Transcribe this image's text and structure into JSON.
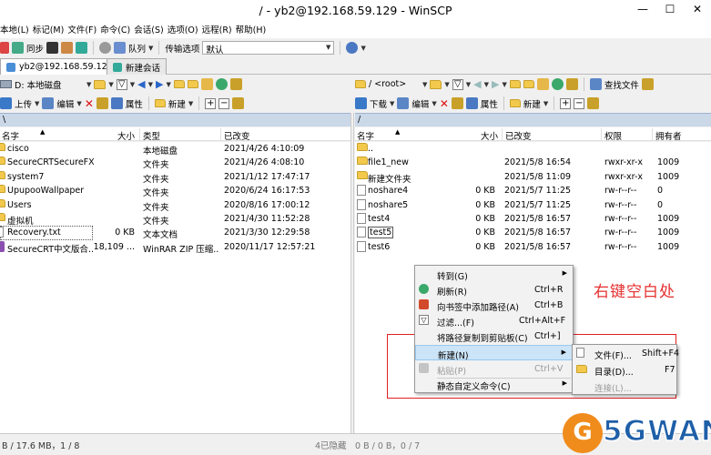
{
  "window": {
    "title": "/ - yb2@192.168.59.129 - WinSCP",
    "minimize": "—",
    "maximize": "☐",
    "close": "✕"
  },
  "menu": [
    "本地(L)",
    "标记(M)",
    "文件(F)",
    "命令(C)",
    "会话(S)",
    "选项(O)",
    "远程(R)",
    "帮助(H)"
  ],
  "toolbar": {
    "sync": "同步",
    "queue": "队列",
    "transfer_label": "传输选项",
    "transfer_value": "默认"
  },
  "tabs": {
    "session": "yb2@192.168.59.129",
    "new_session": "新建会话"
  },
  "local": {
    "drive": "D: 本地磁盘",
    "upload": "上传",
    "edit": "编辑",
    "props": "属性",
    "new": "新建",
    "path": "\\",
    "headers": {
      "name": "名字",
      "size": "大小",
      "type": "类型",
      "changed": "已改变"
    },
    "rows": [
      {
        "name": "cisco",
        "size": "",
        "type": "本地磁盘",
        "changed": "2021/4/26   4:10:09",
        "icon": "folder"
      },
      {
        "name": "SecureCRTSecureFX...",
        "size": "",
        "type": "文件夹",
        "changed": "2021/4/26   4:08:10",
        "icon": "folder"
      },
      {
        "name": "system7",
        "size": "",
        "type": "文件夹",
        "changed": "2021/1/12   17:47:17",
        "icon": "folder"
      },
      {
        "name": "UpupooWallpaper",
        "size": "",
        "type": "文件夹",
        "changed": "2020/6/24   16:17:53",
        "icon": "folder"
      },
      {
        "name": "Users",
        "size": "",
        "type": "文件夹",
        "changed": "2020/8/16   17:00:12",
        "icon": "folder"
      },
      {
        "name": "虚拟机",
        "size": "",
        "type": "文件夹",
        "changed": "2021/4/30   11:52:28",
        "icon": "folder"
      },
      {
        "name": "Recovery.txt",
        "size": "0 KB",
        "type": "文本文档",
        "changed": "2021/3/30   12:29:58",
        "icon": "file"
      },
      {
        "name": "SecureCRT中文版合...",
        "size": "18,109 ...",
        "type": "WinRAR ZIP 压缩...",
        "changed": "2020/11/17   12:57:21",
        "icon": "zip"
      }
    ],
    "status": "B / 17.6 MB，1 / 8"
  },
  "remote": {
    "root": "/ <root>",
    "find": "查找文件",
    "download": "下载",
    "edit": "编辑",
    "props": "属性",
    "new": "新建",
    "path": "/",
    "headers": {
      "name": "名字",
      "size": "大小",
      "changed": "已改变",
      "perms": "权限",
      "owner": "拥有者"
    },
    "rows": [
      {
        "name": "..",
        "size": "",
        "changed": "",
        "perms": "",
        "owner": "",
        "icon": "up"
      },
      {
        "name": "file1_new",
        "size": "",
        "changed": "2021/5/8 16:54",
        "perms": "rwxr-xr-x",
        "owner": "1009",
        "icon": "folder"
      },
      {
        "name": "新建文件夹",
        "size": "",
        "changed": "2021/5/8 11:09",
        "perms": "rwxr-xr-x",
        "owner": "1009",
        "icon": "folder"
      },
      {
        "name": "noshare4",
        "size": "0 KB",
        "changed": "2021/5/7 11:25",
        "perms": "rw-r--r--",
        "owner": "0",
        "icon": "file"
      },
      {
        "name": "noshare5",
        "size": "0 KB",
        "changed": "2021/5/7 11:25",
        "perms": "rw-r--r--",
        "owner": "0",
        "icon": "file"
      },
      {
        "name": "test4",
        "size": "0 KB",
        "changed": "2021/5/8 16:57",
        "perms": "rw-r--r--",
        "owner": "1009",
        "icon": "file"
      },
      {
        "name": "test5",
        "size": "0 KB",
        "changed": "2021/5/8 16:57",
        "perms": "rw-r--r--",
        "owner": "1009",
        "icon": "file"
      },
      {
        "name": "test6",
        "size": "0 KB",
        "changed": "2021/5/8 16:57",
        "perms": "rw-r--r--",
        "owner": "1009",
        "icon": "file"
      }
    ],
    "status_hidden": "4已隐藏",
    "status": "0 B / 0 B，0 / 7"
  },
  "context_menu": {
    "items": [
      {
        "label": "转到(G)",
        "shortcut": "",
        "sub": true
      },
      {
        "label": "刷新(R)",
        "shortcut": "Ctrl+R"
      },
      {
        "label": "向书签中添加路径(A)",
        "shortcut": "Ctrl+B"
      },
      {
        "label": "过滤...(F)",
        "shortcut": "Ctrl+Alt+F"
      },
      {
        "label": "将路径复制到剪贴板(C)",
        "shortcut": "Ctrl+]"
      },
      {
        "label": "新建(N)",
        "shortcut": "",
        "sub": true
      },
      {
        "label": "粘贴(P)",
        "shortcut": "Ctrl+V"
      },
      {
        "label": "静态自定义命令(C)",
        "shortcut": "",
        "sub": true
      }
    ],
    "submenu": [
      {
        "label": "文件(F)...",
        "shortcut": "Shift+F4"
      },
      {
        "label": "目录(D)...",
        "shortcut": "F7"
      },
      {
        "label": "连接(L)...",
        "shortcut": ""
      }
    ]
  },
  "annotation": "右键空白处",
  "logo": {
    "mark": "G",
    "text": "5GWAN"
  },
  "colors": {
    "annotation": "#e63030",
    "path_bar": "#cad8e8",
    "highlight": "#cce4f7",
    "logo_orange": "#f08c1c",
    "logo_blue": "#1f5fa8"
  }
}
